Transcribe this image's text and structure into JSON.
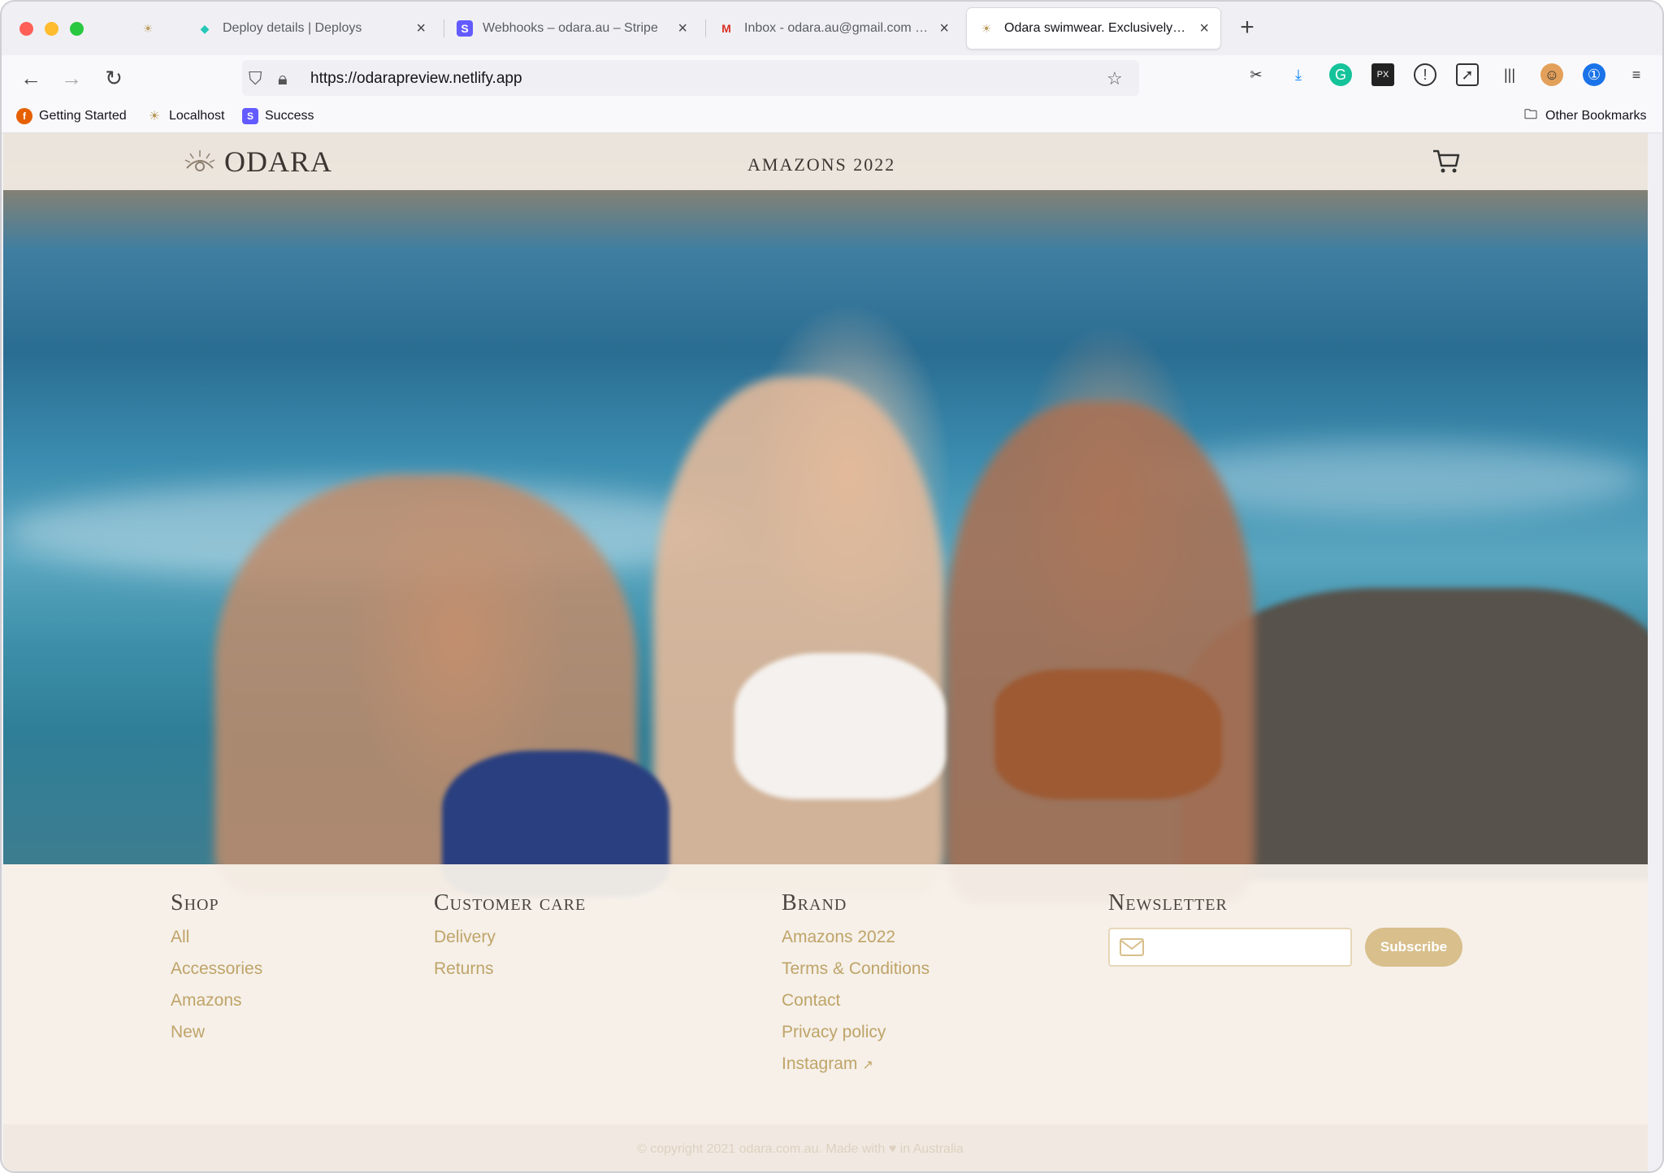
{
  "browser": {
    "tabs": [
      {
        "title": "",
        "favicon": "odara-logo-icon",
        "active": false
      },
      {
        "title": "Deploy details | Deploys",
        "favicon": "netlify-icon",
        "active": false
      },
      {
        "title": "Webhooks – odara.au – Stripe",
        "favicon": "stripe-icon",
        "active": false
      },
      {
        "title": "Inbox - odara.au@gmail.com - G",
        "favicon": "gmail-icon",
        "active": false
      },
      {
        "title": "Odara swimwear. Exclusively onl",
        "favicon": "odara-logo-icon",
        "active": true
      }
    ],
    "url": "https://odarapreview.netlify.app",
    "bookmarks": [
      {
        "label": "Getting Started",
        "icon": "firefox-icon"
      },
      {
        "label": "Localhost",
        "icon": "odara-logo-icon"
      },
      {
        "label": "Success",
        "icon": "stripe-icon"
      }
    ],
    "other_bookmarks": "Other Bookmarks",
    "colors": {
      "stripe": "#635bff",
      "netlify": "#25c7b7",
      "active_tab_bg": "#ffffff"
    }
  },
  "site": {
    "logo_text": "ODARA",
    "nav_collection": "AMAZONS 2022",
    "cart_icon": "cart-icon"
  },
  "footer": {
    "shop": {
      "title": "Shop",
      "links": [
        "All",
        "Accessories",
        "Amazons",
        "New"
      ]
    },
    "customer_care": {
      "title": "Customer care",
      "links": [
        "Delivery",
        "Returns"
      ]
    },
    "brand": {
      "title": "Brand",
      "links": [
        "Amazons 2022",
        "Terms & Conditions",
        "Contact",
        "Privacy policy",
        "Instagram"
      ]
    },
    "newsletter": {
      "title": "Newsletter",
      "email_value": "",
      "subscribe_label": "Subscribe"
    },
    "copyright": "© copyright 2021 odara.com.au. Made with ♥ in Australia",
    "colors": {
      "link": "#bfa468",
      "button": "#d8bf8c"
    }
  }
}
